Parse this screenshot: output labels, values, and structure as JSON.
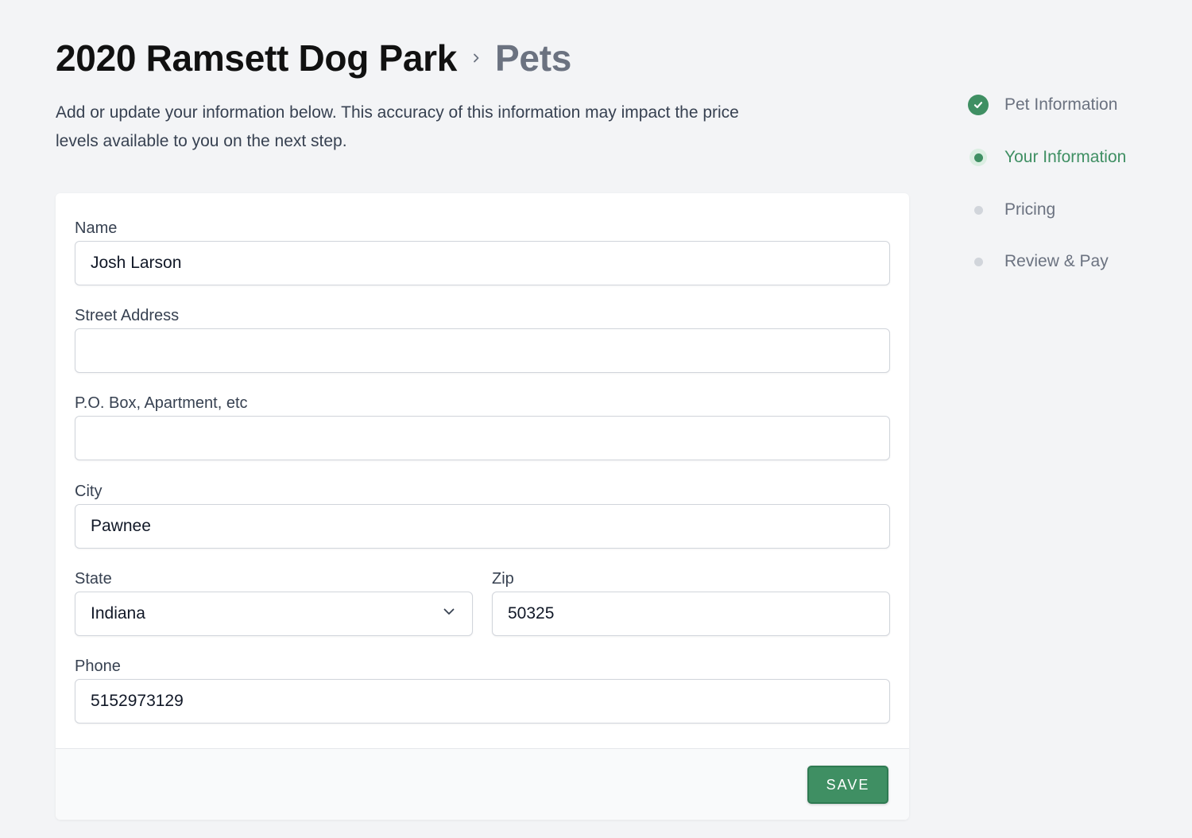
{
  "header": {
    "title": "2020 Ramsett Dog Park",
    "breadcrumb_current": "Pets"
  },
  "description": "Add or update your information below. This accuracy of this information may impact the price levels available to you on the next step.",
  "form": {
    "name": {
      "label": "Name",
      "value": "Josh Larson"
    },
    "street": {
      "label": "Street Address",
      "value": ""
    },
    "po_box": {
      "label": "P.O. Box, Apartment, etc",
      "value": ""
    },
    "city": {
      "label": "City",
      "value": "Pawnee"
    },
    "state": {
      "label": "State",
      "value": "Indiana"
    },
    "zip": {
      "label": "Zip",
      "value": "50325"
    },
    "phone": {
      "label": "Phone",
      "value": "5152973129"
    }
  },
  "footer": {
    "save_label": "SAVE"
  },
  "steps": [
    {
      "label": "Pet Information",
      "status": "complete"
    },
    {
      "label": "Your Information",
      "status": "current"
    },
    {
      "label": "Pricing",
      "status": "upcoming"
    },
    {
      "label": "Review & Pay",
      "status": "upcoming"
    }
  ],
  "colors": {
    "accent": "#3f8f63",
    "background": "#f3f4f6",
    "muted_text": "#6b7280"
  },
  "icons": {
    "breadcrumb_separator": "chevron-right-icon",
    "select_arrow": "chevron-down-icon",
    "step_complete": "check-circle-icon"
  }
}
